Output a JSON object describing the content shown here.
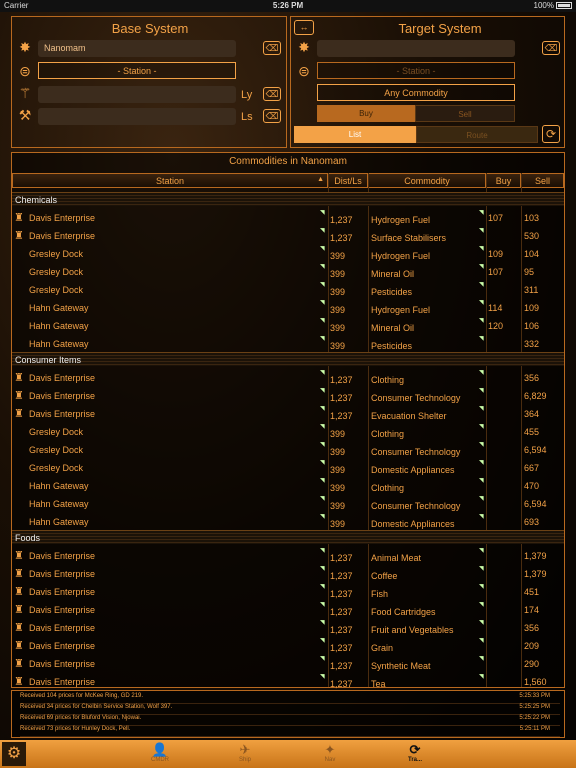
{
  "status": {
    "carrier": "Carrier",
    "time": "5:26 PM",
    "battery": "100%"
  },
  "base": {
    "title": "Base System",
    "system_value": "Nanomam",
    "station_label": "- Station -",
    "ly_unit": "Ly",
    "ls_unit": "Ls"
  },
  "swap_icon": "↔",
  "target": {
    "title": "Target System",
    "station_label": "- Station -",
    "commodity_label": "Any Commodity",
    "buy_label": "Buy",
    "sell_label": "Sell",
    "list_label": "List",
    "route_label": "Route"
  },
  "table": {
    "title": "Commodities in Nanomam",
    "headers": {
      "station": "Station",
      "sort": "▲",
      "dist": "Dist/Ls",
      "commodity": "Commodity",
      "buy": "Buy",
      "sell": "Sell"
    }
  },
  "sections": [
    {
      "name": "Chemicals",
      "rows": [
        {
          "icon": true,
          "station": "Davis Enterprise",
          "dist": "1,237",
          "commodity": "Hydrogen Fuel",
          "buy": "107",
          "sell": "103"
        },
        {
          "icon": true,
          "station": "Davis Enterprise",
          "dist": "1,237",
          "commodity": "Surface Stabilisers",
          "buy": "",
          "sell": "530"
        },
        {
          "icon": false,
          "station": "Gresley Dock",
          "dist": "399",
          "commodity": "Hydrogen Fuel",
          "buy": "109",
          "sell": "104"
        },
        {
          "icon": false,
          "station": "Gresley Dock",
          "dist": "399",
          "commodity": "Mineral Oil",
          "buy": "107",
          "sell": "95"
        },
        {
          "icon": false,
          "station": "Gresley Dock",
          "dist": "399",
          "commodity": "Pesticides",
          "buy": "",
          "sell": "311"
        },
        {
          "icon": false,
          "station": "Hahn Gateway",
          "dist": "399",
          "commodity": "Hydrogen Fuel",
          "buy": "114",
          "sell": "109"
        },
        {
          "icon": false,
          "station": "Hahn Gateway",
          "dist": "399",
          "commodity": "Mineral Oil",
          "buy": "120",
          "sell": "106"
        },
        {
          "icon": false,
          "station": "Hahn Gateway",
          "dist": "399",
          "commodity": "Pesticides",
          "buy": "",
          "sell": "332"
        }
      ]
    },
    {
      "name": "Consumer Items",
      "rows": [
        {
          "icon": true,
          "station": "Davis Enterprise",
          "dist": "1,237",
          "commodity": "Clothing",
          "buy": "",
          "sell": "356"
        },
        {
          "icon": true,
          "station": "Davis Enterprise",
          "dist": "1,237",
          "commodity": "Consumer Technology",
          "buy": "",
          "sell": "6,829"
        },
        {
          "icon": true,
          "station": "Davis Enterprise",
          "dist": "1,237",
          "commodity": "Evacuation Shelter",
          "buy": "",
          "sell": "364"
        },
        {
          "icon": false,
          "station": "Gresley Dock",
          "dist": "399",
          "commodity": "Clothing",
          "buy": "",
          "sell": "455"
        },
        {
          "icon": false,
          "station": "Gresley Dock",
          "dist": "399",
          "commodity": "Consumer Technology",
          "buy": "",
          "sell": "6,594"
        },
        {
          "icon": false,
          "station": "Gresley Dock",
          "dist": "399",
          "commodity": "Domestic Appliances",
          "buy": "",
          "sell": "667"
        },
        {
          "icon": false,
          "station": "Hahn Gateway",
          "dist": "399",
          "commodity": "Clothing",
          "buy": "",
          "sell": "470"
        },
        {
          "icon": false,
          "station": "Hahn Gateway",
          "dist": "399",
          "commodity": "Consumer Technology",
          "buy": "",
          "sell": "6,594"
        },
        {
          "icon": false,
          "station": "Hahn Gateway",
          "dist": "399",
          "commodity": "Domestic Appliances",
          "buy": "",
          "sell": "693"
        }
      ]
    },
    {
      "name": "Foods",
      "rows": [
        {
          "icon": true,
          "station": "Davis Enterprise",
          "dist": "1,237",
          "commodity": "Animal Meat",
          "buy": "",
          "sell": "1,379"
        },
        {
          "icon": true,
          "station": "Davis Enterprise",
          "dist": "1,237",
          "commodity": "Coffee",
          "buy": "",
          "sell": "1,379"
        },
        {
          "icon": true,
          "station": "Davis Enterprise",
          "dist": "1,237",
          "commodity": "Fish",
          "buy": "",
          "sell": "451"
        },
        {
          "icon": true,
          "station": "Davis Enterprise",
          "dist": "1,237",
          "commodity": "Food Cartridges",
          "buy": "",
          "sell": "174"
        },
        {
          "icon": true,
          "station": "Davis Enterprise",
          "dist": "1,237",
          "commodity": "Fruit and Vegetables",
          "buy": "",
          "sell": "356"
        },
        {
          "icon": true,
          "station": "Davis Enterprise",
          "dist": "1,237",
          "commodity": "Grain",
          "buy": "",
          "sell": "209"
        },
        {
          "icon": true,
          "station": "Davis Enterprise",
          "dist": "1,237",
          "commodity": "Synthetic Meat",
          "buy": "",
          "sell": "290"
        },
        {
          "icon": true,
          "station": "Davis Enterprise",
          "dist": "1,237",
          "commodity": "Tea",
          "buy": "",
          "sell": "1,560"
        }
      ]
    }
  ],
  "log": [
    {
      "text": "Received 104 prices for McKee Ring, GD 219.",
      "time": "5:25:33 PM"
    },
    {
      "text": "Received 34 prices for Chelbin Service Station, Wolf 397.",
      "time": "5:25:25 PM"
    },
    {
      "text": "Received 69 prices for Bluford Vision, Njowai.",
      "time": "5:25:22 PM"
    },
    {
      "text": "Received 73 prices for Hunley Dock, Pell.",
      "time": "5:25:11 PM"
    }
  ],
  "tabs": [
    {
      "label": "CMDR",
      "icon": "👤"
    },
    {
      "label": "Ship",
      "icon": "✈"
    },
    {
      "label": "Nav",
      "icon": "✦"
    },
    {
      "label": "Tra...",
      "icon": "⟳"
    }
  ],
  "colors": {
    "accent": "#f3a247",
    "frame": "#b8691f"
  }
}
